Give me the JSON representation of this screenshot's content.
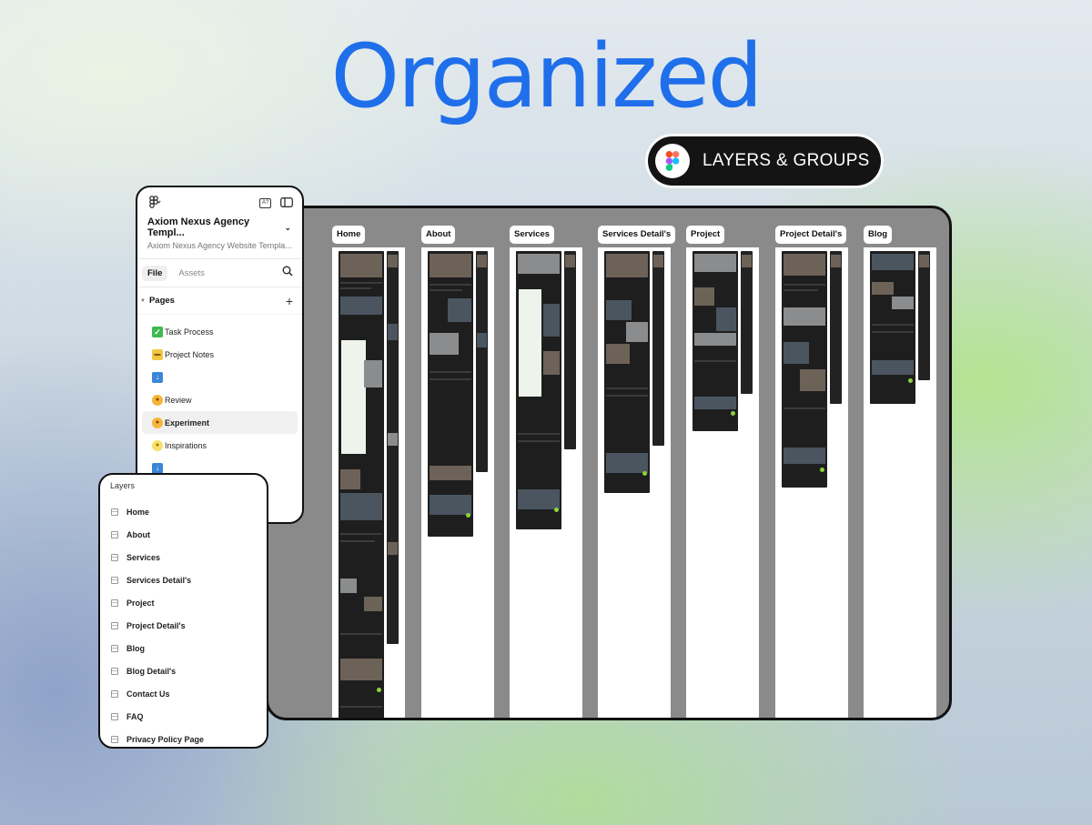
{
  "headline": "Organized",
  "badge": {
    "label": "LAYERS & GROUPS",
    "icon": "figma-icon"
  },
  "canvas": {
    "frames": [
      {
        "label": "Home"
      },
      {
        "label": "About"
      },
      {
        "label": "Services"
      },
      {
        "label": "Services Detail's"
      },
      {
        "label": "Project"
      },
      {
        "label": "Project Detail's"
      },
      {
        "label": "Blog"
      }
    ]
  },
  "pages_panel": {
    "file_title": "Axiom Nexus Agency Templ...",
    "file_subtitle": "Axiom Nexus Agency Website Templa...",
    "tabs": [
      "File",
      "Assets"
    ],
    "active_tab": "File",
    "section_title": "Pages",
    "pages": [
      {
        "icon": "check-icon",
        "label": "Task Process"
      },
      {
        "icon": "folder-icon",
        "label": "Project Notes"
      },
      {
        "icon": "down-arrow-icon",
        "label": ""
      },
      {
        "icon": "worker-icon",
        "label": "Review"
      },
      {
        "icon": "worker-icon",
        "label": "Experiment",
        "selected": true
      },
      {
        "icon": "bulb-icon",
        "label": "Inspirations"
      },
      {
        "icon": "down-arrow-icon",
        "label": ""
      }
    ]
  },
  "layers_panel": {
    "title": "Layers",
    "items": [
      "Home",
      "About",
      "Services",
      "Services Detail's",
      "Project",
      "Project Detail's",
      "Blog",
      "Blog Detail's",
      "Contact Us",
      "FAQ",
      "Privacy Policy Page"
    ]
  },
  "colors": {
    "accent": "#1f6feb",
    "badge_bg": "#141414",
    "canvas_bg": "#8a8a8a",
    "mock_lime": "#8cd33a"
  }
}
